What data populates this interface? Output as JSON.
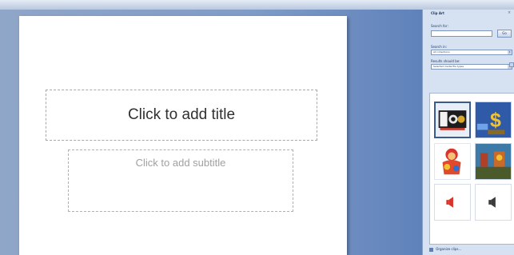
{
  "slide": {
    "title_placeholder": "Click to add title",
    "subtitle_placeholder": "Click to add subtitle"
  },
  "clip_art_pane": {
    "title": "Clip Art",
    "search_for_label": "Search for:",
    "search_value": "",
    "go_button": "Go",
    "search_in_label": "Search in:",
    "search_in_value": "All collections",
    "results_type_label": "Results should be:",
    "results_type_value": "Selected media file types",
    "footer_link": "Organize clips...",
    "results": [
      {
        "icon": "movie-clipart-icon"
      },
      {
        "icon": "dollar-clipart-icon"
      },
      {
        "icon": "character-clipart-icon"
      },
      {
        "icon": "scene-clipart-icon"
      },
      {
        "icon": "sound-clipart-icon"
      },
      {
        "icon": "sound-clipart-icon"
      }
    ]
  }
}
